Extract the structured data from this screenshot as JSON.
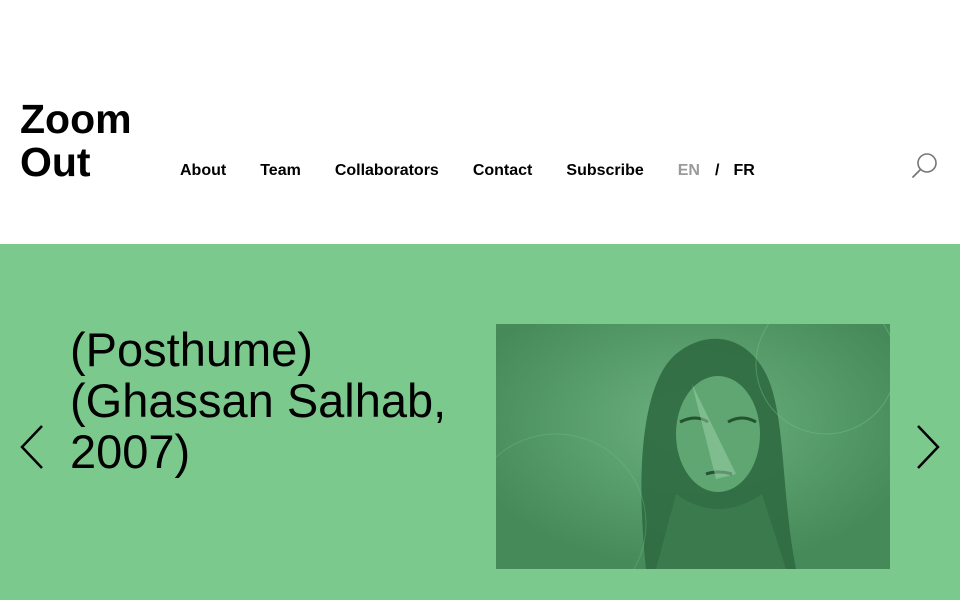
{
  "logo": {
    "line1": "Zoom",
    "line2": "Out"
  },
  "nav": {
    "items": [
      {
        "label": "About"
      },
      {
        "label": "Team"
      },
      {
        "label": "Collaborators"
      },
      {
        "label": "Contact"
      },
      {
        "label": "Subscribe"
      }
    ],
    "language": {
      "en": "EN",
      "separator": "/",
      "fr": "FR",
      "active": "EN"
    }
  },
  "search": {
    "icon": "search-icon"
  },
  "hero": {
    "title": "(Posthume)\n(Ghassan Salhab,\n2007)",
    "background": "#7cc98d",
    "image": {
      "tint": "#4f9864"
    },
    "prev_icon": "chevron-left-icon",
    "next_icon": "chevron-right-icon"
  }
}
